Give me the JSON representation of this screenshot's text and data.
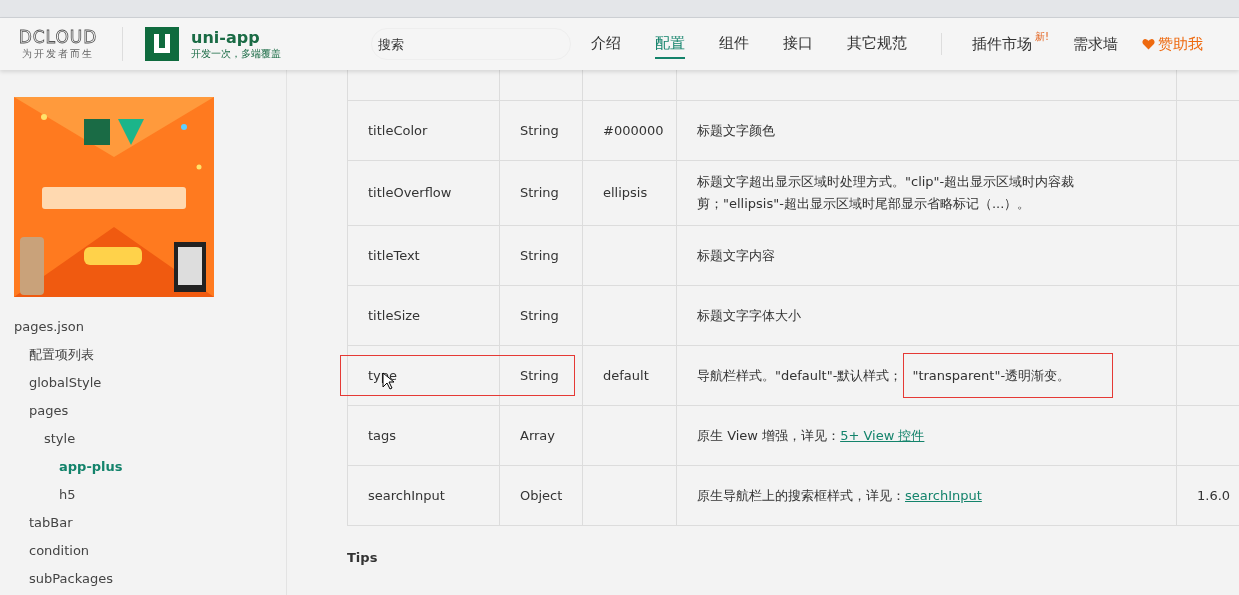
{
  "header": {
    "dcloud_logo": "DCLOUD",
    "dcloud_slogan": "为开发者而生",
    "app_name": "uni-app",
    "app_slogan": "开发一次，多端覆盖",
    "search": {
      "placeholder": "搜索"
    },
    "nav": [
      {
        "label": "介绍",
        "selected": false
      },
      {
        "label": "配置",
        "selected": true
      },
      {
        "label": "组件",
        "selected": false
      },
      {
        "label": "接口",
        "selected": false
      },
      {
        "label": "其它规范",
        "selected": false
      }
    ],
    "nav_right": [
      {
        "label": "插件市场",
        "badge": "新!",
        "kind": "plain"
      },
      {
        "label": "需求墙",
        "kind": "plain"
      },
      {
        "label": "赞助我",
        "kind": "sponsor"
      }
    ]
  },
  "sidebar": {
    "items": [
      {
        "label": "pages.json",
        "selected": false,
        "children": [
          {
            "label": "配置项列表",
            "selected": false
          },
          {
            "label": "globalStyle",
            "selected": false
          },
          {
            "label": "pages",
            "selected": false,
            "children": [
              {
                "label": "style",
                "selected": false,
                "children": [
                  {
                    "label": "app-plus",
                    "selected": true
                  },
                  {
                    "label": "h5",
                    "selected": false
                  }
                ]
              }
            ]
          },
          {
            "label": "tabBar",
            "selected": false
          },
          {
            "label": "condition",
            "selected": false
          },
          {
            "label": "subPackages",
            "selected": false
          }
        ]
      }
    ]
  },
  "table": {
    "rows": [
      {
        "name": "titleColor",
        "type": "String",
        "default": "#000000",
        "description": [
          {
            "kind": "text",
            "text": "标题文字颜色"
          }
        ]
      },
      {
        "name": "titleOverflow",
        "type": "String",
        "default": "ellipsis",
        "description": [
          {
            "kind": "text",
            "text": "标题文字超出显示区域时处理方式。\"clip\"-超出显示区域时内容裁剪；\"ellipsis\"-超出显示区域时尾部显示省略标记（...）。"
          }
        ]
      },
      {
        "name": "titleText",
        "type": "String",
        "description": [
          {
            "kind": "text",
            "text": "标题文字内容"
          }
        ]
      },
      {
        "name": "titleSize",
        "type": "String",
        "description": [
          {
            "kind": "text",
            "text": "标题文字字体大小"
          }
        ]
      },
      {
        "name": "type",
        "type": "String",
        "default": "default",
        "boxed": true,
        "pointer": true,
        "description": [
          {
            "kind": "text",
            "text": "导航栏样式。\"default\"-默认样式；"
          },
          {
            "kind": "boxed",
            "text": "\"transparent\"-透明渐变。"
          }
        ]
      },
      {
        "name": "tags",
        "type": "Array",
        "description": [
          {
            "kind": "text",
            "text": "原生 View 增强，详见："
          },
          {
            "kind": "link",
            "text": "5+ View 控件"
          }
        ]
      },
      {
        "name": "searchInput",
        "type": "Object",
        "description": [
          {
            "kind": "text",
            "text": "原生导航栏上的搜索框样式，详见："
          },
          {
            "kind": "link",
            "text": "searchInput"
          }
        ],
        "version": "1.6.0"
      }
    ]
  },
  "tips": {
    "title": "Tips"
  }
}
